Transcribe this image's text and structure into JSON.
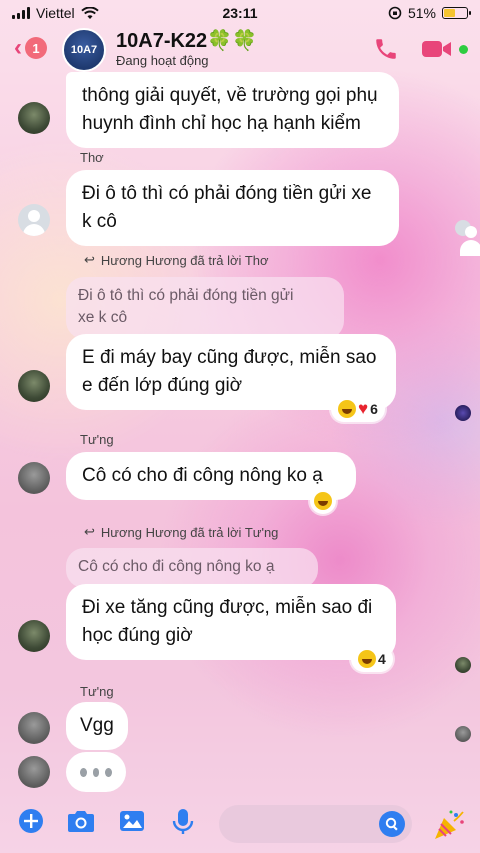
{
  "status_bar": {
    "carrier": "Viettel",
    "time": "23:11",
    "battery_percent": "51%",
    "battery_level": 0.51
  },
  "header": {
    "unread_count": "1",
    "group_avatar_text": "10A7",
    "group_name": "10A7-K22🍀🍀",
    "status": "Đang hoạt động",
    "icons": [
      "back-chevron-icon",
      "phone-icon",
      "video-camera-icon"
    ]
  },
  "messages": [
    {
      "id": "m1",
      "text_lines": [
        "thông giải quyết, về trường gọi phụ",
        "huynh đình chỉ học hạ hạnh kiểm"
      ]
    },
    {
      "id": "m2",
      "sender": "Thơ",
      "text_lines": [
        "Đi ô tô thì có phải đóng tiền gửi xe",
        "k cô"
      ]
    },
    {
      "id": "m3",
      "reply_label": "Hương Hương đã trả lời Thơ",
      "quoted_lines": [
        "Đi ô tô thì có phải đóng tiền gửi",
        "xe k cô"
      ],
      "text_lines": [
        "E đi máy bay cũng được, miễn sao",
        "e đến lớp đúng giờ"
      ],
      "reaction_count": "6"
    },
    {
      "id": "m4",
      "sender": "Tư'ng",
      "text_lines": [
        "Cô có cho đi công nông ko ạ"
      ]
    },
    {
      "id": "m5",
      "reply_label": "Hương Hương đã trả lời Tư'ng",
      "quoted_lines": [
        "Cô có cho đi công nông ko ạ"
      ],
      "text_lines": [
        "Đi xe tăng cũng được, miễn sao đi",
        "học đúng giờ"
      ],
      "reaction_count": "4"
    },
    {
      "id": "m6",
      "sender": "Tư'ng",
      "text_lines": [
        "Vgg"
      ]
    }
  ],
  "composer": {
    "icons": [
      "plus-icon",
      "camera-icon",
      "image-icon",
      "microphone-icon",
      "search-icon",
      "party-popper-icon"
    ]
  },
  "colors": {
    "accent": "#2f7ef0",
    "back_color": "#e8457a",
    "online": "#2ecc40"
  }
}
